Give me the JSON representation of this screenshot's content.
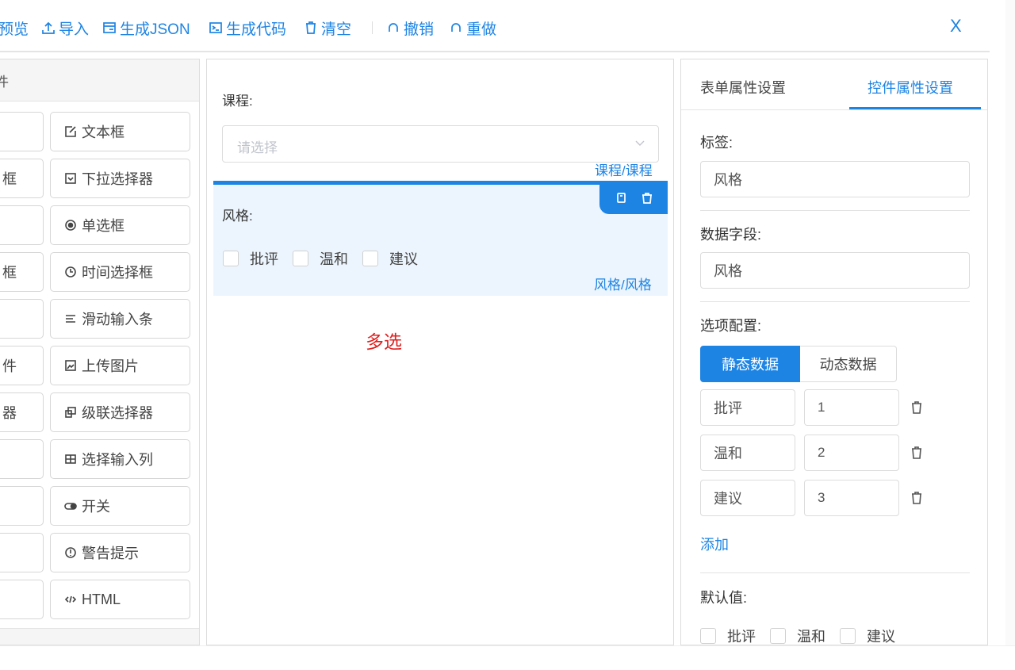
{
  "toolbar": {
    "preview": "预览",
    "import": "导入",
    "gen_json": "生成JSON",
    "gen_code": "生成代码",
    "clear": "清空",
    "undo": "撤销",
    "redo": "重做",
    "close": "X"
  },
  "left_panel": {
    "header": "件",
    "left_items": [
      "",
      "框",
      "",
      "框",
      "",
      "件",
      "器",
      "",
      "",
      "",
      ""
    ],
    "right_items": [
      {
        "label": "文本框",
        "icon": "edit-icon"
      },
      {
        "label": "下拉选择器",
        "icon": "dropdown-icon"
      },
      {
        "label": "单选框",
        "icon": "radio-icon"
      },
      {
        "label": "时间选择框",
        "icon": "clock-icon"
      },
      {
        "label": "滑动输入条",
        "icon": "slider-icon"
      },
      {
        "label": "上传图片",
        "icon": "image-icon"
      },
      {
        "label": "级联选择器",
        "icon": "cascader-icon"
      },
      {
        "label": "选择输入列",
        "icon": "grid-icon"
      },
      {
        "label": "开关",
        "icon": "switch-icon"
      },
      {
        "label": "警告提示",
        "icon": "alert-icon"
      },
      {
        "label": "HTML",
        "icon": "code-icon"
      }
    ]
  },
  "canvas": {
    "field1": {
      "label": "课程:",
      "placeholder": "请选择",
      "path": "课程/课程"
    },
    "field2": {
      "label": "风格:",
      "options": [
        "批评",
        "温和",
        "建议"
      ],
      "path": "风格/风格"
    },
    "note": "多选"
  },
  "settings": {
    "tabs": [
      "表单属性设置",
      "控件属性设置"
    ],
    "active_tab": 1,
    "label_title": "标签:",
    "label_value": "风格",
    "field_title": "数据字段:",
    "field_value": "风格",
    "options_title": "选项配置:",
    "data_modes": [
      "静态数据",
      "动态数据"
    ],
    "options": [
      {
        "label": "批评",
        "value": "1"
      },
      {
        "label": "温和",
        "value": "2"
      },
      {
        "label": "建议",
        "value": "3"
      }
    ],
    "add": "添加",
    "default_title": "默认值:",
    "default_options": [
      "批评",
      "温和",
      "建议"
    ]
  },
  "colors": {
    "accent": "#1e84e3",
    "note": "#e02020",
    "active_bg": "#ecf5fd"
  }
}
